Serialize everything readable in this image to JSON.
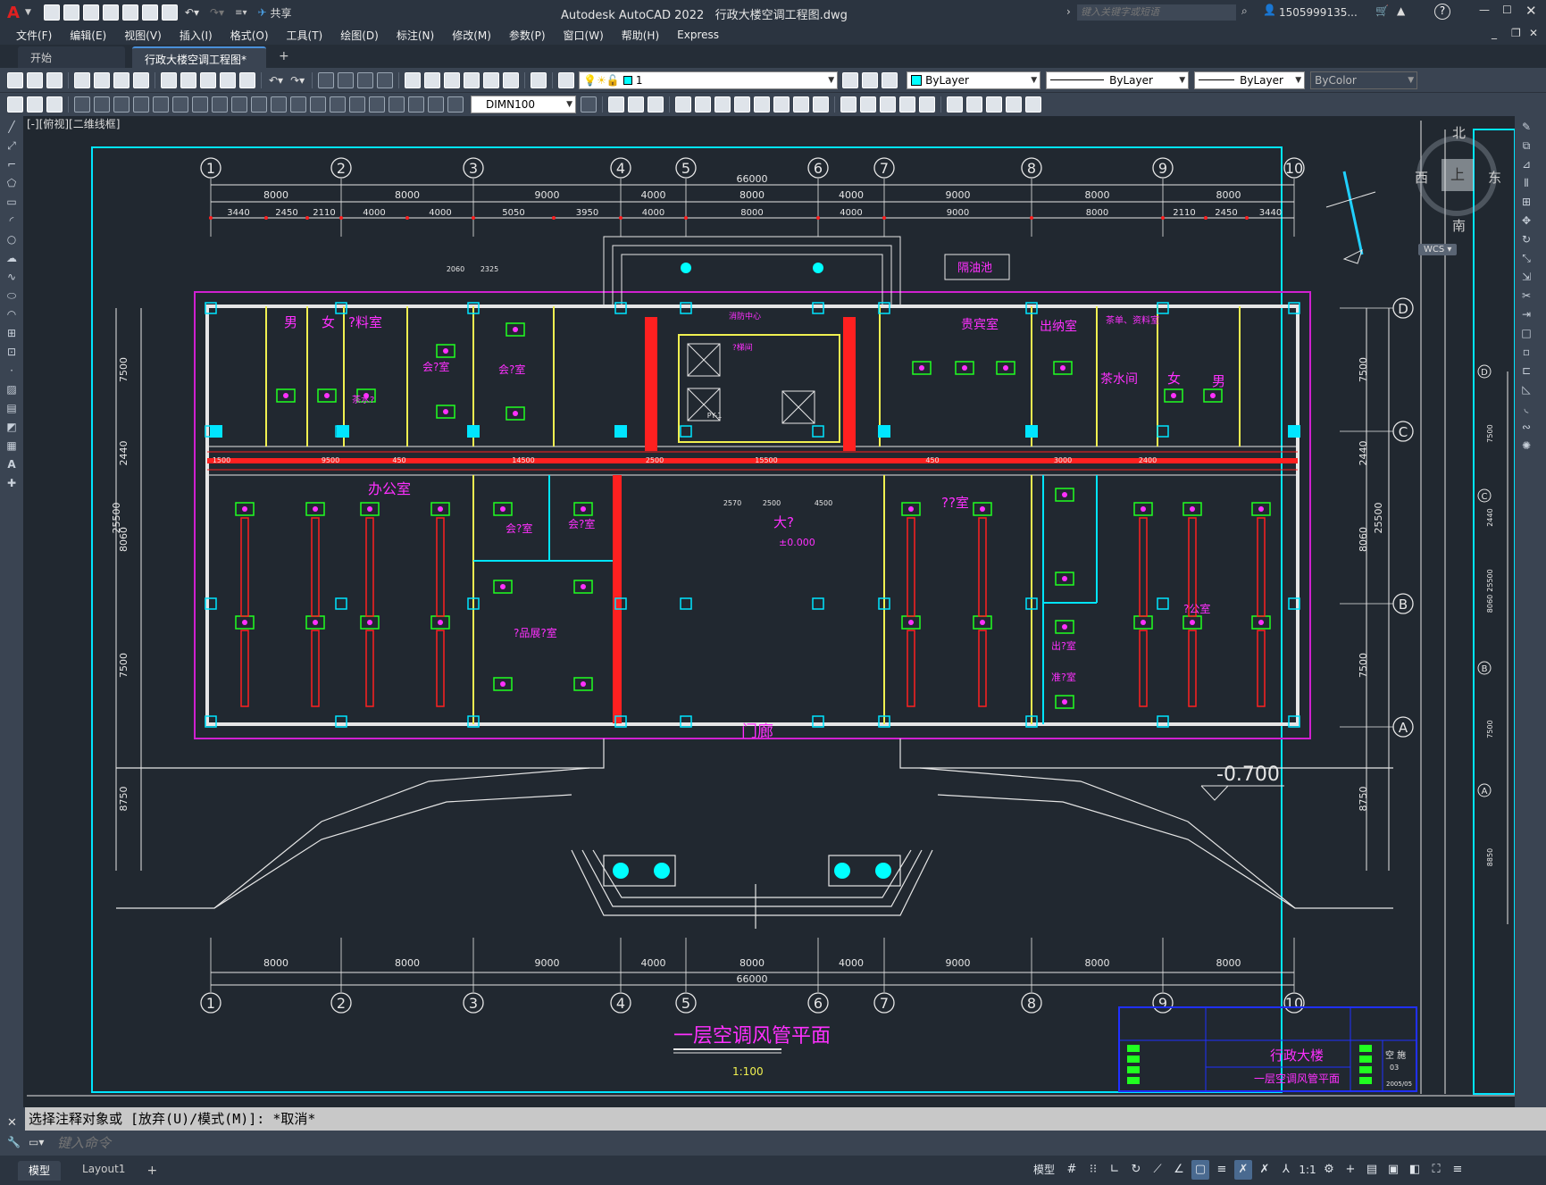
{
  "app": {
    "title": "Autodesk AutoCAD 2022",
    "file": "行政大楼空调工程图.dwg",
    "share": "共享",
    "search_placeholder": "键入关键字或短语",
    "user": "1505999135...",
    "help": "?"
  },
  "menu": [
    "文件(F)",
    "编辑(E)",
    "视图(V)",
    "插入(I)",
    "格式(O)",
    "工具(T)",
    "绘图(D)",
    "标注(N)",
    "修改(M)",
    "参数(P)",
    "窗口(W)",
    "帮助(H)",
    "Express"
  ],
  "tabs": {
    "start": "开始",
    "drawing": "行政大楼空调工程图*",
    "close": "×",
    "add": "+"
  },
  "toolbar": {
    "layer": "1",
    "color": "ByLayer",
    "linetype": "ByLayer",
    "lineweight": "ByLayer",
    "plotstyle": "ByColor",
    "dimstyle": "DIMN100"
  },
  "viewport": {
    "label": "[-][俯视][二维线框]"
  },
  "viewcube": {
    "north": "北",
    "south": "南",
    "east": "东",
    "west": "西",
    "top": "上",
    "wcs": "WCS"
  },
  "drawing": {
    "grid_top": [
      "1",
      "2",
      "3",
      "4",
      "5",
      "6",
      "7",
      "8",
      "9",
      "10"
    ],
    "grid_side_left": [
      "D",
      "C",
      "B",
      "A"
    ],
    "grid_side_right": [
      "D",
      "C",
      "B",
      "A"
    ],
    "grid_side_right_offset": [
      "D",
      "C",
      "B",
      "A"
    ],
    "total_dim": "66000",
    "dims_row1": [
      "8000",
      "8000",
      "9000",
      "4000",
      "8000",
      "4000",
      "9000",
      "8000",
      "8000"
    ],
    "dims_row2": [
      "3440",
      "2450",
      "2110",
      "4000",
      "4000",
      "5050",
      "3950",
      "4000",
      "8000",
      "4000",
      "9000",
      "8000",
      "2110",
      "2450",
      "3440"
    ],
    "dims_bottom": [
      "8000",
      "8000",
      "9000",
      "4000",
      "8000",
      "4000",
      "9000",
      "8000",
      "8000"
    ],
    "side_dims_left": [
      "7500",
      "2440",
      "8060",
      "7500",
      "8750"
    ],
    "side_total_left": "25500",
    "side_dims_right": [
      "7500",
      "2440",
      "8060",
      "7500",
      "8750"
    ],
    "side_total_right": "25500",
    "side_dims_far_right": [
      "7500",
      "2440",
      "8060",
      "7500",
      "8850"
    ],
    "side_total_far_right": "25500",
    "rooms": {
      "male1": "男",
      "female1": "女",
      "material": "?料室",
      "tea1": "茶水?",
      "meeting1": "会?室",
      "meeting2": "会?室",
      "office_big": "办公室",
      "meeting3": "会?室",
      "meeting4": "会?室",
      "exhibit": "?品展?室",
      "lobby": "大?",
      "elev": "±0.000",
      "porch": "门廊",
      "office_r": "??室",
      "guest": "贵宾室",
      "cashier": "出纳室",
      "archive": "茶单、资料室",
      "tea2": "茶水间",
      "female2": "女",
      "male2": "男",
      "office_r2": "?公室",
      "out_room": "出?室",
      "prep_room": "准?室",
      "oil_tank": "隔油池",
      "fire_center": "消防中心",
      "ele_room": "?梯间",
      "level_minus": "-0.700"
    },
    "small_labels": [
      "2060",
      "2325",
      "PY-1",
      "1500",
      "9500",
      "450",
      "14500",
      "2500",
      "15500",
      "3000",
      "2400",
      "2500",
      "2570",
      "4500",
      "450"
    ],
    "title": "一层空调风管平面",
    "scale": "1:100",
    "titleblock": {
      "project": "行政大楼",
      "sheet_title": "一层空调风管平面",
      "discipline": "空 施",
      "sheet_no": "03",
      "date": "2005/05"
    }
  },
  "command": {
    "history": "选择注释对象或 [放弃(U)/模式(M)]: *取消*",
    "placeholder": "键入命令"
  },
  "layouts": [
    "模型",
    "Layout1",
    "+"
  ],
  "status": {
    "model": "模型",
    "scale": "1:1"
  }
}
